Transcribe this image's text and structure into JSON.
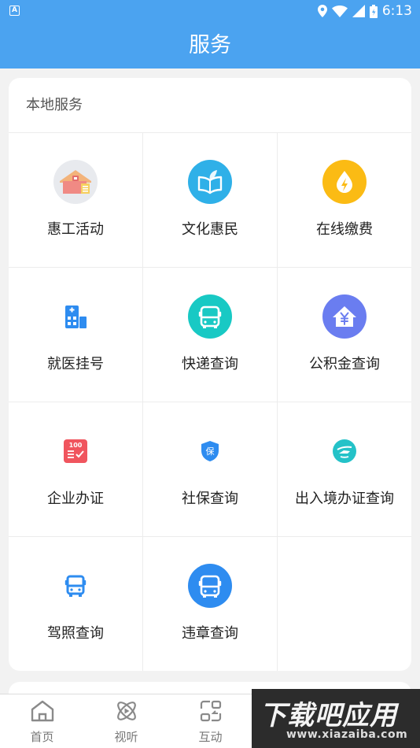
{
  "status_bar": {
    "time": "6:13",
    "badge": "A"
  },
  "header": {
    "title": "服务"
  },
  "section": {
    "title": "本地服务",
    "items": [
      {
        "label": "惠工活动",
        "icon": "house-gift-icon"
      },
      {
        "label": "文化惠民",
        "icon": "book-leaf-icon"
      },
      {
        "label": "在线缴费",
        "icon": "lightning-drop-icon"
      },
      {
        "label": "就医挂号",
        "icon": "hospital-building-icon"
      },
      {
        "label": "快递查询",
        "icon": "bus-icon"
      },
      {
        "label": "公积金查询",
        "icon": "yuan-house-icon"
      },
      {
        "label": "企业办证",
        "icon": "certificate-100-icon"
      },
      {
        "label": "社保查询",
        "icon": "insurance-shield-icon"
      },
      {
        "label": "出入境办证查询",
        "icon": "plane-globe-icon"
      },
      {
        "label": "驾照查询",
        "icon": "bus-small-icon"
      },
      {
        "label": "违章查询",
        "icon": "bus-round-icon"
      }
    ]
  },
  "tabs": [
    {
      "label": "首页",
      "icon": "home-icon"
    },
    {
      "label": "视听",
      "icon": "atom-play-icon"
    },
    {
      "label": "互动",
      "icon": "interaction-icon"
    }
  ],
  "watermark": {
    "title": "下载吧应用",
    "url": "www.xiazaiba.com"
  },
  "colors": {
    "primary": "#4ba3f0",
    "background": "#f2f2f2"
  }
}
